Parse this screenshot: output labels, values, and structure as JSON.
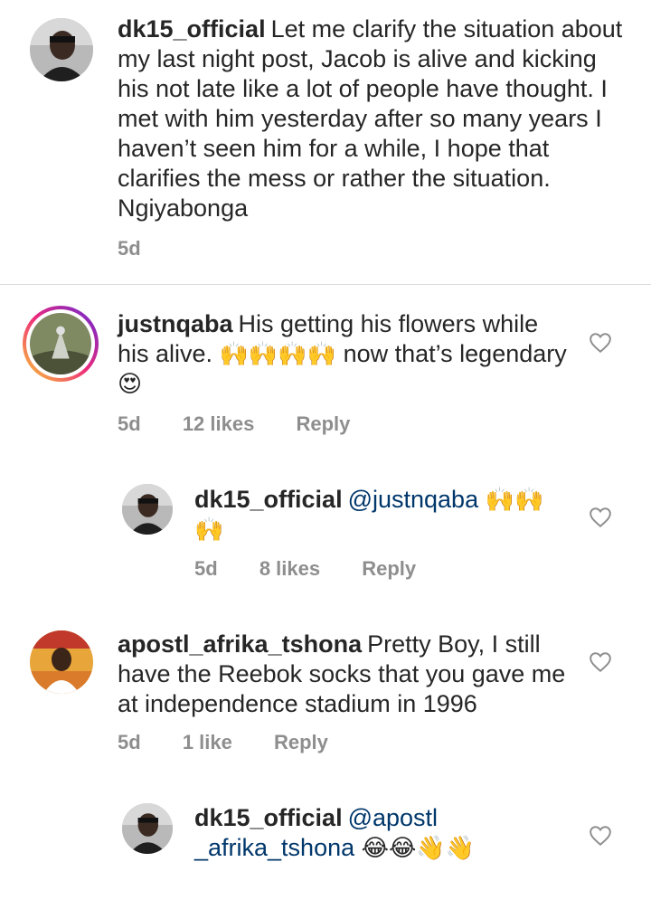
{
  "comments": [
    {
      "username": "dk15_official",
      "text": "Let me clarify the situation about my last night post, Jacob is alive and kicking his not late like a lot of people have thought. I met with him yesterday after so many years I haven’t seen him for a while, I hope that clarifies the mess or rather the situation. Ngiyabonga",
      "time": "5d"
    },
    {
      "username": "justnqaba",
      "text_a": "His getting his flowers while his alive.",
      "emoji_a": "🙌🙌🙌🙌",
      "text_b": "now that’s legendary",
      "emoji_b": "😍",
      "time": "5d",
      "likes": "12 likes",
      "reply": "Reply"
    },
    {
      "username": "dk15_official",
      "mention": "@justnqaba",
      "emoji": "🙌🙌🙌",
      "time": "5d",
      "likes": "8 likes",
      "reply": "Reply"
    },
    {
      "username": "apostl_afrika_tshona",
      "text": "Pretty Boy, I still have the Reebok socks that you gave me at independence stadium in 1996",
      "time": "5d",
      "likes": "1 like",
      "reply": "Reply"
    },
    {
      "username": "dk15_official",
      "mention": "@apostl_afrika_tshona",
      "mention_line1": "@apostl",
      "mention_line2": "_afrika_tshona",
      "emoji": "😂😂👋👋"
    }
  ],
  "colors": {
    "text": "#262626",
    "meta": "#8e8e8e",
    "mention": "#00376b",
    "divider": "#dbdbdb"
  },
  "icons": [
    "heart-outline-icon"
  ]
}
